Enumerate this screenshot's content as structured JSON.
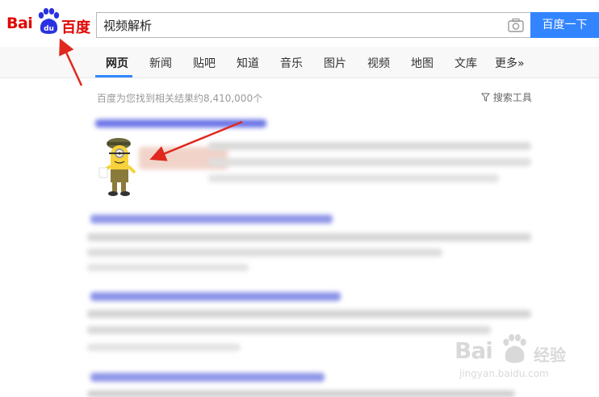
{
  "header": {
    "logo_text_latin": "Bai",
    "logo_text_du": "du",
    "logo_text_cn": "百度",
    "search_value": "视频解析",
    "search_button_label": "百度一下",
    "camera_icon": "camera-icon"
  },
  "nav": {
    "items": [
      "网页",
      "新闻",
      "贴吧",
      "知道",
      "音乐",
      "图片",
      "视频",
      "地图",
      "文库",
      "更多»"
    ],
    "active": "网页"
  },
  "results": {
    "count_text": "百度为您找到相关结果约8,410,000个",
    "tools_label": "搜索工具"
  },
  "watermark": {
    "brand": "Bai",
    "brand_cn": "经验",
    "url": "jingyan.baidu.com"
  },
  "colors": {
    "brand_red": "#e10602",
    "brand_blue": "#3385ff",
    "arrow_red": "#e0281e"
  }
}
